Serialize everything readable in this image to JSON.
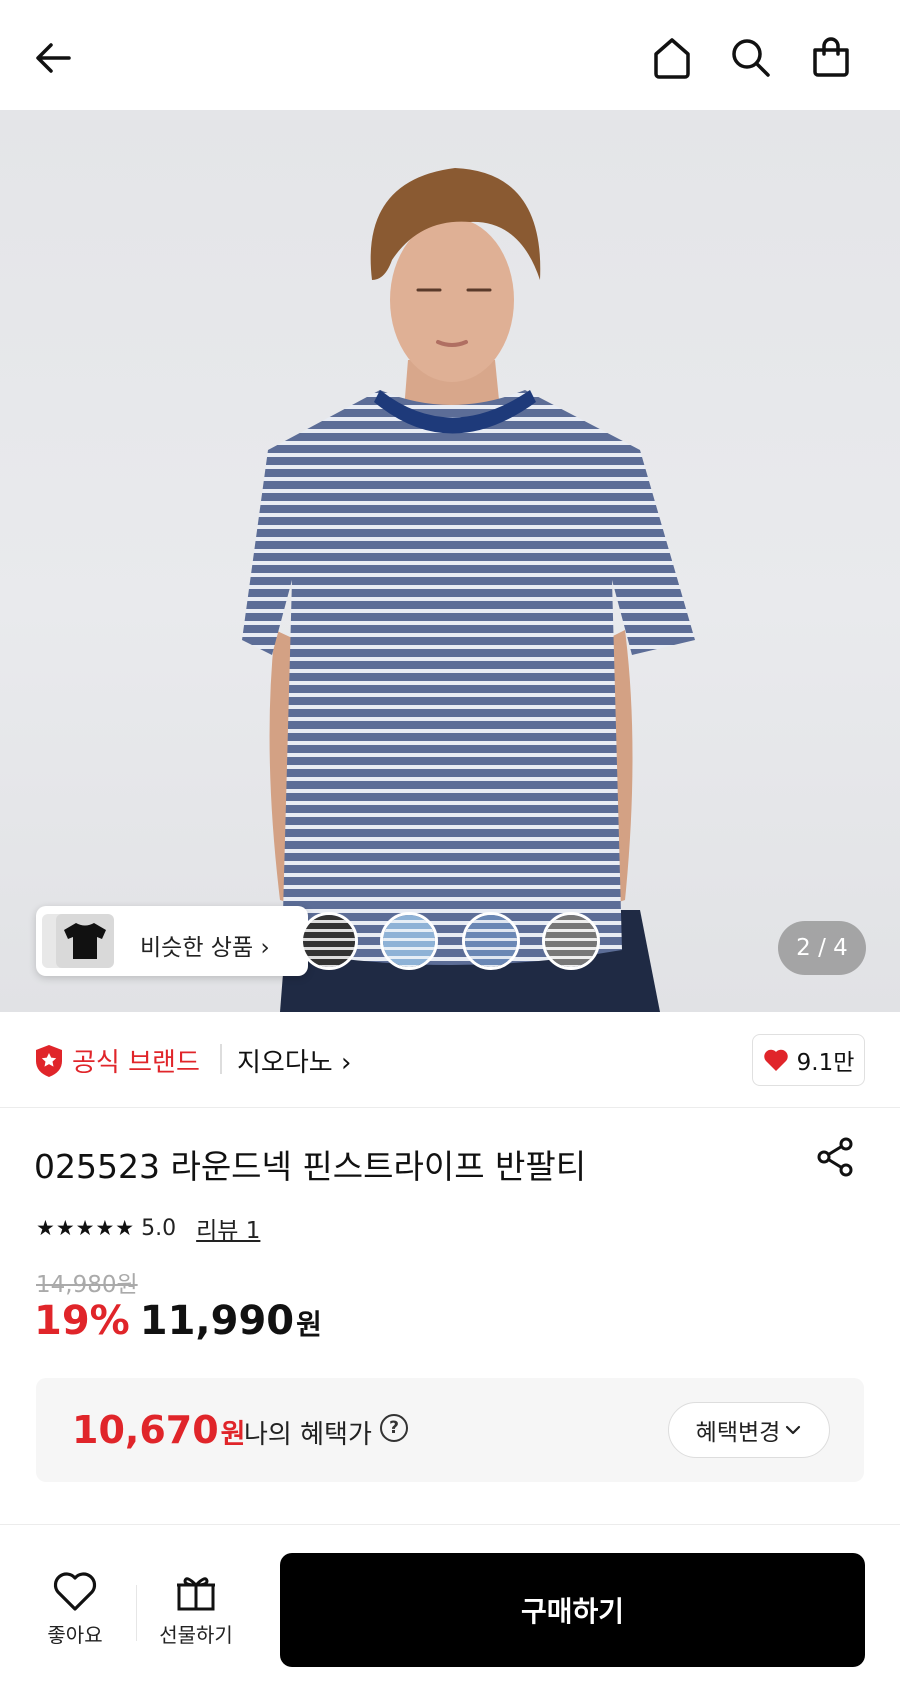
{
  "header": {
    "back_icon": "arrow-left-icon",
    "home_icon": "home-icon",
    "search_icon": "search-icon",
    "cart_icon": "shopping-bag-icon"
  },
  "hero": {
    "similar_label": "비슷한 상품",
    "counter": "2 / 4",
    "swatches": [
      "black-stripe",
      "light-blue-stripe",
      "blue-stripe",
      "gray-stripe"
    ]
  },
  "brand": {
    "official_label": "공식 브랜드",
    "name": "지오다노",
    "like_count": "9.1만"
  },
  "product": {
    "title": "025523 라운드넥 핀스트라이프 반팔티",
    "stars": "★★★★★",
    "score": "5.0",
    "review_label": "리뷰 1",
    "original_price": "14,980원",
    "discount": "19%",
    "price": "11,990",
    "won": "원"
  },
  "benefit": {
    "price": "10,670",
    "won": "원",
    "label": "나의 혜택가",
    "help": "?",
    "change_label": "혜택변경"
  },
  "bottom": {
    "like_label": "좋아요",
    "gift_label": "선물하기",
    "buy_label": "구매하기"
  },
  "colors": {
    "accent_red": "#e0252a",
    "buy_button": "#000000"
  }
}
